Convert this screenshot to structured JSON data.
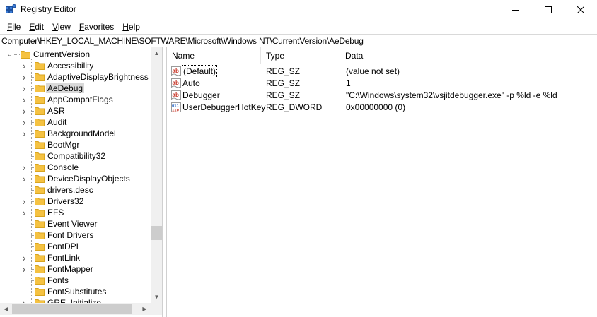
{
  "window": {
    "title": "Registry Editor",
    "controls": {
      "minimize": "—",
      "maximize": "☐",
      "close": "✕"
    }
  },
  "menu": [
    {
      "label": "File",
      "accel": "F",
      "rest": "ile"
    },
    {
      "label": "Edit",
      "accel": "E",
      "rest": "dit"
    },
    {
      "label": "View",
      "accel": "V",
      "rest": "iew"
    },
    {
      "label": "Favorites",
      "accel": "F",
      "rest": "avorites"
    },
    {
      "label": "Help",
      "accel": "H",
      "rest": "elp"
    }
  ],
  "address": "Computer\\HKEY_LOCAL_MACHINE\\SOFTWARE\\Microsoft\\Windows NT\\CurrentVersion\\AeDebug",
  "tree": {
    "root": {
      "label": "CurrentVersion",
      "expander": "⌄"
    },
    "items": [
      {
        "label": "Accessibility",
        "has_children": true
      },
      {
        "label": "AdaptiveDisplayBrightness",
        "has_children": true
      },
      {
        "label": "AeDebug",
        "has_children": true,
        "selected": true
      },
      {
        "label": "AppCompatFlags",
        "has_children": true
      },
      {
        "label": "ASR",
        "has_children": true
      },
      {
        "label": "Audit",
        "has_children": true
      },
      {
        "label": "BackgroundModel",
        "has_children": true
      },
      {
        "label": "BootMgr",
        "has_children": false
      },
      {
        "label": "Compatibility32",
        "has_children": false
      },
      {
        "label": "Console",
        "has_children": true
      },
      {
        "label": "DeviceDisplayObjects",
        "has_children": true
      },
      {
        "label": "drivers.desc",
        "has_children": false
      },
      {
        "label": "Drivers32",
        "has_children": true
      },
      {
        "label": "EFS",
        "has_children": true
      },
      {
        "label": "Event Viewer",
        "has_children": false
      },
      {
        "label": "Font Drivers",
        "has_children": false
      },
      {
        "label": "FontDPI",
        "has_children": false
      },
      {
        "label": "FontLink",
        "has_children": true
      },
      {
        "label": "FontMapper",
        "has_children": true
      },
      {
        "label": "Fonts",
        "has_children": false
      },
      {
        "label": "FontSubstitutes",
        "has_children": false
      },
      {
        "label": "GRE_Initialize",
        "has_children": true
      }
    ]
  },
  "list": {
    "columns": {
      "name": "Name",
      "type": "Type",
      "data": "Data"
    },
    "rows": [
      {
        "name": "(Default)",
        "type": "REG_SZ",
        "data": "(value not set)",
        "icon": "string-value-icon",
        "focused": true
      },
      {
        "name": "Auto",
        "type": "REG_SZ",
        "data": "1",
        "icon": "string-value-icon"
      },
      {
        "name": "Debugger",
        "type": "REG_SZ",
        "data": "\"C:\\Windows\\system32\\vsjitdebugger.exe\" -p %ld -e %ld",
        "icon": "string-value-icon"
      },
      {
        "name": "UserDebuggerHotKey",
        "type": "REG_DWORD",
        "data": "0x00000000 (0)",
        "icon": "binary-value-icon"
      }
    ]
  },
  "colors": {
    "folder": "#f5c242",
    "string_icon_red": "#c42b1c",
    "binary_icon_blue": "#1f5fbf",
    "selection": "#d9d9d9"
  }
}
